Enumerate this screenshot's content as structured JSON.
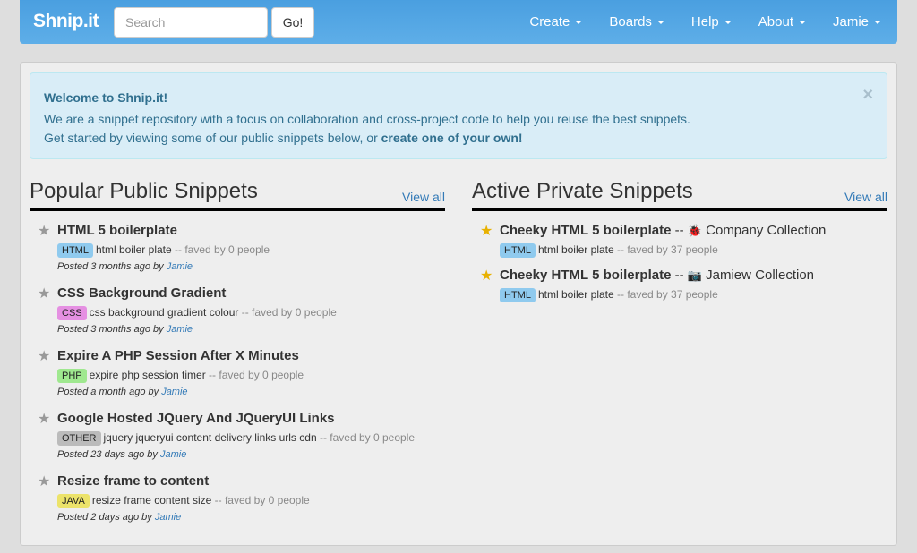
{
  "nav": {
    "brand": "Shnip.it",
    "search_placeholder": "Search",
    "go": "Go!",
    "menu": [
      "Create",
      "Boards",
      "Help",
      "About",
      "Jamie"
    ]
  },
  "alert": {
    "title": "Welcome to Shnip.it!",
    "line1": "We are a snippet repository with a focus on collaboration and cross-project code to help you reuse the best snippets.",
    "line2": "Get started by viewing some of our public snippets below, or ",
    "line2_link": "create one of your own!",
    "close": "×"
  },
  "popular": {
    "heading": "Popular Public Snippets",
    "view_all": "View all",
    "items": [
      {
        "title": "HTML 5 boilerplate",
        "label": "HTML",
        "color": "#8fcaee",
        "desc": "html boiler plate",
        "faves": "-- faved by 0 people",
        "posted": "Posted 3 months ago by ",
        "author": "Jamie"
      },
      {
        "title": "CSS Background Gradient",
        "label": "CSS",
        "color": "#e590e2",
        "desc": "css background gradient colour",
        "faves": "-- faved by 0 people",
        "posted": "Posted 3 months ago by ",
        "author": "Jamie"
      },
      {
        "title": "Expire A PHP Session After X Minutes",
        "label": "PHP",
        "color": "#9fe88f",
        "desc": "expire php session timer",
        "faves": "-- faved by 0 people",
        "posted": "Posted a month ago by ",
        "author": "Jamie"
      },
      {
        "title": "Google Hosted JQuery And JQueryUI Links",
        "label": "OTHER",
        "color": "#bbbbbb",
        "desc": "jquery jqueryui content delivery links urls cdn",
        "faves": "-- faved by 0 people",
        "posted": "Posted 23 days ago by ",
        "author": "Jamie"
      },
      {
        "title": "Resize frame to content",
        "label": "JAVA",
        "color": "#ece36a",
        "desc": "resize frame content size",
        "faves": "-- faved by 0 people",
        "posted": "Posted 2 days ago by ",
        "author": "Jamie"
      }
    ]
  },
  "private": {
    "heading": "Active Private Snippets",
    "view_all": "View all",
    "items": [
      {
        "title": "Cheeky HTML 5 boilerplate",
        "sep": " -- ",
        "icon": "bug-icon",
        "glyph": "🐞",
        "collection": "Company Collection",
        "label": "HTML",
        "color": "#8fcaee",
        "desc": "html boiler plate",
        "faves": "-- faved by 37 people"
      },
      {
        "title": "Cheeky HTML 5 boilerplate",
        "sep": " -- ",
        "icon": "camera-icon",
        "glyph": "📷",
        "collection": "Jamiew Collection",
        "label": "HTML",
        "color": "#8fcaee",
        "desc": "html boiler plate",
        "faves": "-- faved by 37 people"
      }
    ]
  }
}
